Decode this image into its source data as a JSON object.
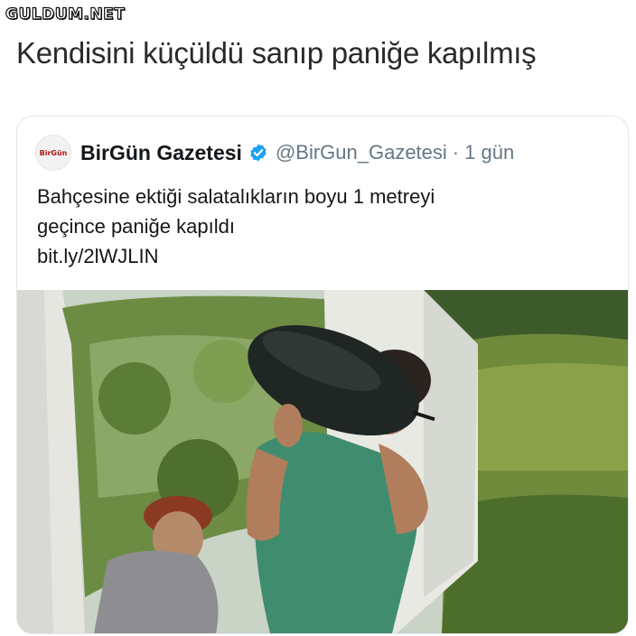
{
  "watermark": "GULDUM.NET",
  "caption": "Kendisini küçüldü sanıp paniğe kapılmış",
  "tweet": {
    "avatar_text": "BirGün",
    "display_name": "BirGün Gazetesi",
    "handle": "@BirGun_Gazetesi",
    "separator": "·",
    "time": "1 gün",
    "text_lines": [
      "Bahçesine ektiği salatalıkların boyu 1 metreyi",
      "geçince paniğe kapıldı",
      "bit.ly/2lWJLIN"
    ]
  },
  "colors": {
    "verified": "#1DA1F2",
    "handle": "#657786",
    "text": "#14171a"
  }
}
